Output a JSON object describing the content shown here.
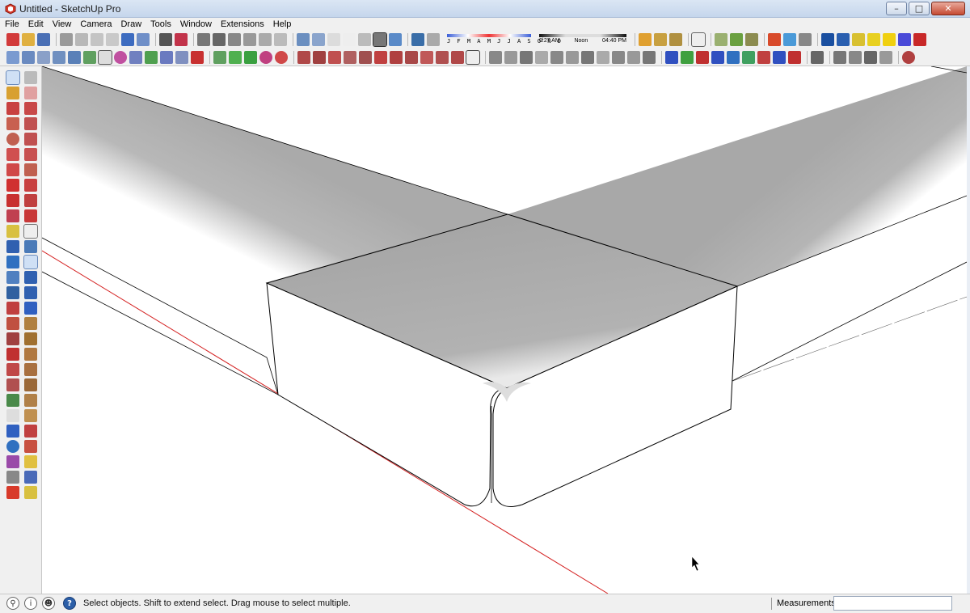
{
  "window": {
    "title": "Untitled - SketchUp Pro",
    "controls": {
      "minimize": "–",
      "maximize": "□",
      "close": "✕"
    }
  },
  "menu": [
    "File",
    "Edit",
    "View",
    "Camera",
    "Draw",
    "Tools",
    "Window",
    "Extensions",
    "Help"
  ],
  "shadow_settings": {
    "months": "J F M A M J J A S O N D",
    "time_start": "0̸:27 AM",
    "time_noon": "Noon",
    "time_end": "04:40 PM"
  },
  "status": {
    "hint": "Select objects. Shift to extend select. Drag mouse to select multiple.",
    "measurements_label": "Measurements",
    "measurements_value": ""
  },
  "colors": {
    "red_axis": "#d42020",
    "face_top": "#a9a9a9",
    "face_side": "#ffffff",
    "edge": "#000000"
  }
}
